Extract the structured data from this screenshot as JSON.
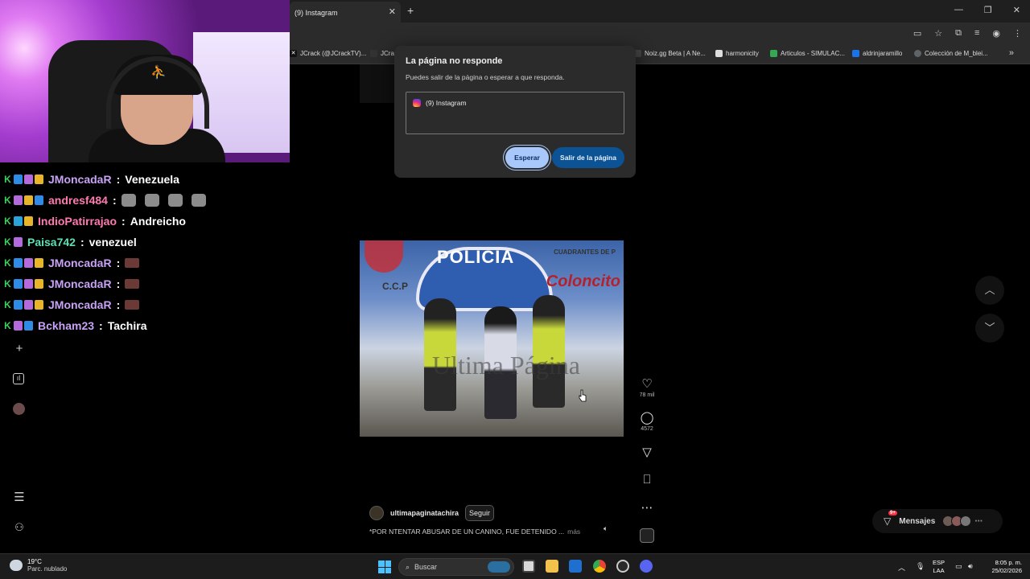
{
  "browser": {
    "tab_title": "(9) Instagram",
    "tab_close": "✕",
    "new_tab": "+",
    "window_controls": [
      "—",
      "❐",
      "✕"
    ],
    "toolbar_icons": [
      "install-icon",
      "star-icon",
      "extensions-icon",
      "media-icon",
      "profile-icon",
      "menu-icon"
    ],
    "bookmarks": [
      {
        "label": "JCrack (@JCrackTV)...",
        "icon_color": "#111111"
      },
      {
        "label": "JCra",
        "icon_color": "#333333"
      },
      {
        "label": "Noiz.gg Beta | A Ne...",
        "icon_color": "#444444"
      },
      {
        "label": "harmonicity",
        "icon_color": "#dddddd"
      },
      {
        "label": "Articulos - SIMULAC...",
        "icon_color": "#34a853"
      },
      {
        "label": "aldrinjaramillo",
        "icon_color": "#1a73e8"
      },
      {
        "label": "Colección de M_blei...",
        "icon_color": "#5f6368"
      }
    ],
    "bookmarks_more": "»"
  },
  "dialog": {
    "title": "La página no responde",
    "text": "Puedes salir de la página o esperar a que responda.",
    "list_item": "(9) Instagram",
    "wait_button": "Esperar",
    "exit_button": "Salir de la página"
  },
  "chat": [
    {
      "user": "JMoncadaR",
      "color": "#c7a2f5",
      "badges": [
        "k",
        "blue",
        "purple",
        "gold"
      ],
      "message": "Venezuela",
      "emotes": 0,
      "small_emotes": 0
    },
    {
      "user": "andresf484",
      "color": "#ff7ab0",
      "badges": [
        "k",
        "purple",
        "gold",
        "blue"
      ],
      "message": "",
      "emotes": 4,
      "small_emotes": 0
    },
    {
      "user": "IndioPatirrajao",
      "color": "#ff7ab0",
      "badges": [
        "k",
        "cube",
        "gold"
      ],
      "message": "Andreicho",
      "emotes": 0,
      "small_emotes": 0
    },
    {
      "user": "Paisa742",
      "color": "#5ce0b5",
      "badges": [
        "k",
        "purple"
      ],
      "message": "venezuel",
      "emotes": 0,
      "small_emotes": 0
    },
    {
      "user": "JMoncadaR",
      "color": "#c7a2f5",
      "badges": [
        "k",
        "blue",
        "purple",
        "gold"
      ],
      "message": "",
      "emotes": 0,
      "small_emotes": 1
    },
    {
      "user": "JMoncadaR",
      "color": "#c7a2f5",
      "badges": [
        "k",
        "blue",
        "purple",
        "gold"
      ],
      "message": "",
      "emotes": 0,
      "small_emotes": 1
    },
    {
      "user": "JMoncadaR",
      "color": "#c7a2f5",
      "badges": [
        "k",
        "blue",
        "purple",
        "gold"
      ],
      "message": "",
      "emotes": 0,
      "small_emotes": 1
    },
    {
      "user": "Bckham23",
      "color": "#c7a2f5",
      "badges": [
        "k",
        "purple",
        "blue"
      ],
      "message": "Tachira",
      "emotes": 0,
      "small_emotes": 0
    }
  ],
  "chat_separator": ":",
  "reel": {
    "video_text": {
      "policia": "POLICIA",
      "colon": "Coloncito",
      "cuadrantes": "CUADRANTES DE P",
      "ccp": "C.C.P",
      "watermark": "Ultima Página"
    },
    "likes": "78 mil",
    "comments": "4572",
    "author": "ultimapaginatachira",
    "follow": "Seguir",
    "caption": "*POR NTENTAR ABUSAR DE UN CANINO, FUE DETENIDO ...",
    "more": "más"
  },
  "messages": {
    "label": "Mensajes",
    "badge": "9+"
  },
  "taskbar": {
    "weather_temp": "19°C",
    "weather_desc": "Parc. nublado",
    "search_placeholder": "Buscar",
    "lang_top": "ESP",
    "lang_bottom": "LAA",
    "time": "8:05 p. m.",
    "date": "25/02/2026"
  }
}
